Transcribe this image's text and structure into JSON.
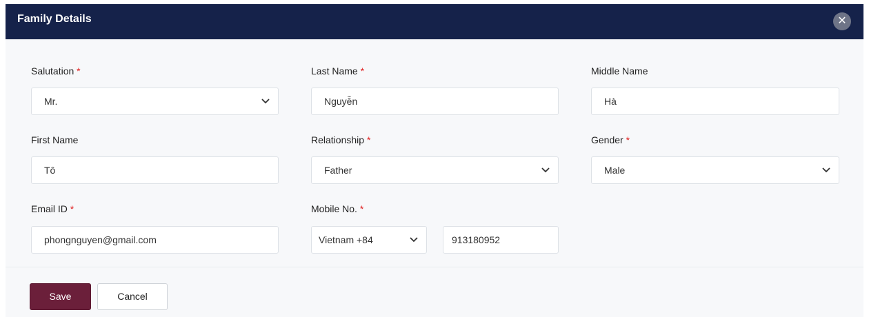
{
  "dialog": {
    "title": "Family Details",
    "close_icon": "close-icon"
  },
  "required_marker": "*",
  "fields": {
    "salutation": {
      "label": "Salutation",
      "value": "Mr.",
      "required": true
    },
    "last_name": {
      "label": "Last Name",
      "value": "Nguyễn",
      "required": true
    },
    "middle_name": {
      "label": "Middle Name",
      "value": "Hà",
      "required": false
    },
    "first_name": {
      "label": "First Name",
      "value": "Tô",
      "required": false
    },
    "relationship": {
      "label": "Relationship",
      "value": "Father",
      "required": true
    },
    "gender": {
      "label": "Gender",
      "value": "Male",
      "required": true
    },
    "email": {
      "label": "Email ID",
      "value": "phongnguyen@gmail.com",
      "required": true
    },
    "mobile": {
      "label": "Mobile No.",
      "country_code": "Vietnam +84",
      "number": "913180952",
      "required": true
    }
  },
  "buttons": {
    "save": "Save",
    "cancel": "Cancel"
  },
  "colors": {
    "header_bg": "#15224a",
    "save_bg": "#6b1f3a",
    "required": "#e02020"
  }
}
